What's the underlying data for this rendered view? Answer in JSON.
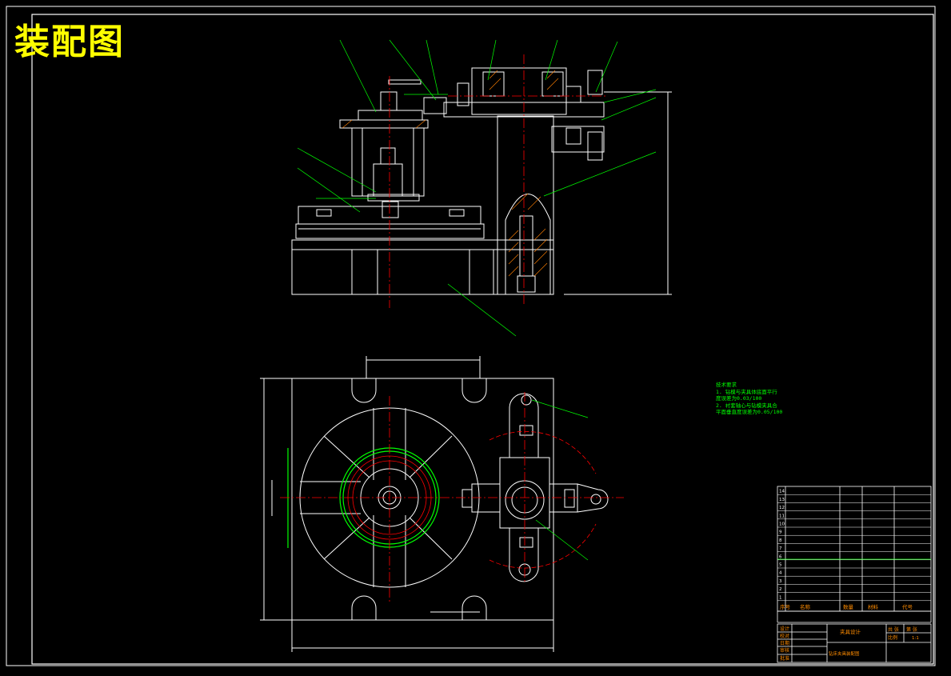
{
  "title": "装配图",
  "tech_requirements": {
    "heading": "技术要求",
    "lines": [
      "1. 钻模与夹具体底面平行",
      "度误差为0.03/100",
      "2. 衬套轴心与钻模夹具合",
      "平面垂直度误差为0.05/100"
    ]
  },
  "parts_list": {
    "rows": [
      {
        "no": "14"
      },
      {
        "no": "13"
      },
      {
        "no": "12"
      },
      {
        "no": "11"
      },
      {
        "no": "10"
      },
      {
        "no": "9"
      },
      {
        "no": "8"
      },
      {
        "no": "7"
      },
      {
        "no": "6"
      },
      {
        "no": "5"
      },
      {
        "no": "4"
      },
      {
        "no": "3"
      },
      {
        "no": "2"
      },
      {
        "no": "1"
      }
    ],
    "header": {
      "no": "序号",
      "name": "名称",
      "qty": "数量",
      "material": "材料",
      "code": "代号"
    }
  },
  "title_block": {
    "design_label": "设计",
    "check_label": "校对",
    "date_label": "日期",
    "review_label": "审核",
    "approve_label": "批准",
    "drawing_name": "夹具设计",
    "part_title": "钻床夹具装配图",
    "sheet_total": "共 张",
    "sheet_no": "第 张",
    "scale_label": "比例",
    "scale_value": "1:1"
  },
  "colors": {
    "line": "#ffffff",
    "center": "#ff0000",
    "leader": "#00ff00",
    "hatch": "#ff8000",
    "table_text": "#ff8c00",
    "title": "#ffff00"
  }
}
